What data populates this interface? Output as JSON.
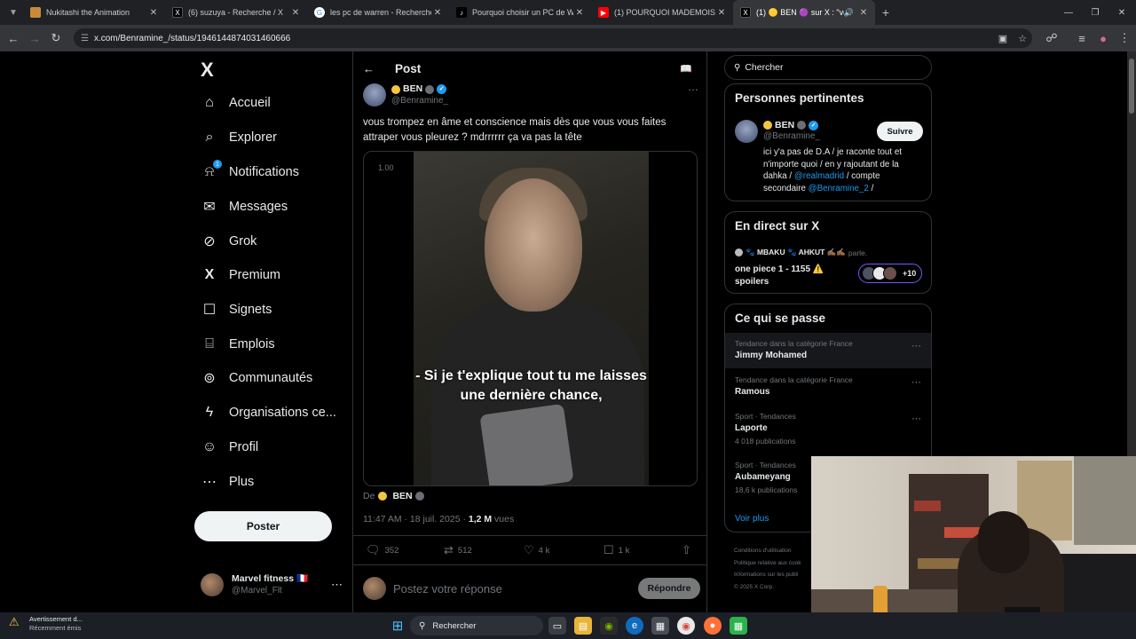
{
  "browser": {
    "tabs": [
      {
        "title": "Nukitashi the Animation",
        "fav_color": "#c98b3a",
        "fav_icon": "image-favicon",
        "active": false
      },
      {
        "title": "(6) suzuya - Recherche / X",
        "fav_color": "#000000",
        "fav_icon": "x-favicon",
        "active": false
      },
      {
        "title": "les pc de warren - Recherche G",
        "fav_color": "#4285f4",
        "fav_icon": "google-favicon",
        "active": false
      },
      {
        "title": "Pourquoi choisir un PC de Warr",
        "fav_color": "#000000",
        "fav_icon": "tiktok-favicon",
        "active": false
      },
      {
        "title": "(1) POURQUOI MADEMOISELLE",
        "fav_color": "#ff0000",
        "fav_icon": "youtube-favicon",
        "active": false
      },
      {
        "title": "(1) 🟡 BEN 🟣 sur X : \"vous",
        "fav_color": "#000000",
        "fav_icon": "x-favicon",
        "active": true
      }
    ],
    "url": "x.com/Benramine_/status/1946144874031460666"
  },
  "nav": {
    "logo": "X",
    "items": [
      {
        "label": "Accueil",
        "icon": "home-icon",
        "glyph": "⌂"
      },
      {
        "label": "Explorer",
        "icon": "search-icon",
        "glyph": "⌕"
      },
      {
        "label": "Notifications",
        "icon": "bell-icon",
        "glyph": "⍾",
        "badge": "1"
      },
      {
        "label": "Messages",
        "icon": "mail-icon",
        "glyph": "✉"
      },
      {
        "label": "Grok",
        "icon": "grok-icon",
        "glyph": "⊘"
      },
      {
        "label": "Premium",
        "icon": "x-premium-icon",
        "glyph": "X"
      },
      {
        "label": "Signets",
        "icon": "bookmark-icon",
        "glyph": "☐"
      },
      {
        "label": "Emplois",
        "icon": "briefcase-icon",
        "glyph": "⌸"
      },
      {
        "label": "Communautés",
        "icon": "communities-icon",
        "glyph": "⊚"
      },
      {
        "label": "Organisations ce...",
        "icon": "lightning-icon",
        "glyph": "ϟ"
      },
      {
        "label": "Profil",
        "icon": "profile-icon",
        "glyph": "☺"
      },
      {
        "label": "Plus",
        "icon": "more-circle-icon",
        "glyph": "⋯"
      }
    ],
    "post_button": "Poster",
    "account": {
      "name": "Marvel fitness 🇫🇷",
      "handle": "@Marvel_Flt"
    }
  },
  "post": {
    "header_title": "Post",
    "author_name": "BEN",
    "author_handle": "@Benramine_",
    "text": "vous trompez en âme et conscience mais dès que vous vous faites attraper vous pleurez ? mdrrrrrr ça va pas la tête",
    "video_speed": "1.00",
    "subtitle_line1": "- Si je t'explique tout tu me laisses",
    "subtitle_line2": "une dernière chance,",
    "from_prefix": "De",
    "from_name": "BEN",
    "time": "11:47 AM · 18 juil. 2025 · ",
    "views_count": "1,2 M",
    "views_label": " vues",
    "replies": "352",
    "reposts": "512",
    "likes": "4 k",
    "bookmarks": "1 k",
    "reply_placeholder": "Postez votre réponse",
    "reply_button": "Répondre"
  },
  "sidebar": {
    "search_placeholder": "Chercher",
    "relevant": {
      "title": "Personnes pertinentes",
      "name": "BEN",
      "handle": "@Benramine_",
      "follow": "Suivre",
      "bio_part1": "ici y'a pas de D.A / je raconte tout et n'importe quoi / en y rajoutant de la dahka / ",
      "bio_link1": "@realmadrid",
      "bio_part2": " / compte secondaire ",
      "bio_link2": "@Benramine_2",
      "bio_part3": " /"
    },
    "live": {
      "title": "En direct sur X",
      "source": "🐾 MBAKU 🐾 AHKUT ✍🏾✍🏾",
      "speaks": "parle.",
      "topic": "one piece 1 - 1155 ⚠️ spoilers",
      "extra": "+10"
    },
    "trends": {
      "title": "Ce qui se passe",
      "items": [
        {
          "category": "Tendance dans la catégorie France",
          "name": "Jimmy Mohamed",
          "count": ""
        },
        {
          "category": "Tendance dans la catégorie France",
          "name": "Ramous",
          "count": ""
        },
        {
          "category": "Sport · Tendances",
          "name": "Laporte",
          "count": "4 018 publications"
        },
        {
          "category": "Sport · Tendances",
          "name": "Aubameyang",
          "count": "18,6 k publications"
        }
      ],
      "see_more": "Voir plus"
    },
    "footer": [
      "Conditions d'utilisation",
      "Politique relative aux cook",
      "Informations sur les publi",
      "© 2025 X Corp."
    ]
  },
  "taskbar": {
    "notif_title": "Avertissement d...",
    "notif_sub": "Récemment émis",
    "search_placeholder": "Rechercher"
  }
}
